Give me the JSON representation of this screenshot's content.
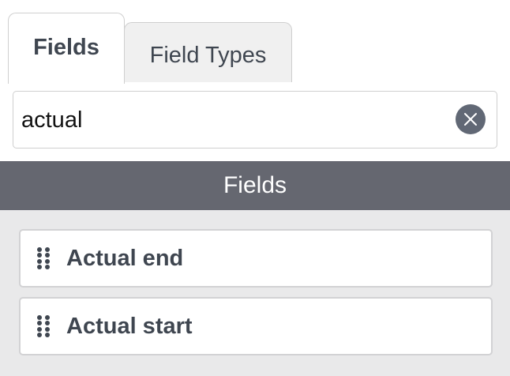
{
  "tabs": {
    "fields_label": "Fields",
    "field_types_label": "Field Types",
    "active": "Fields"
  },
  "search": {
    "value": "actual",
    "clear_icon": "close-icon"
  },
  "section": {
    "title": "Fields"
  },
  "fields": [
    {
      "label": "Actual end",
      "handle_icon": "drag-handle-icon"
    },
    {
      "label": "Actual start",
      "handle_icon": "drag-handle-icon"
    }
  ],
  "colors": {
    "header_bg": "#656770",
    "list_bg": "#e9e9ea",
    "text": "#3f4650",
    "clear_button": "#616875"
  }
}
